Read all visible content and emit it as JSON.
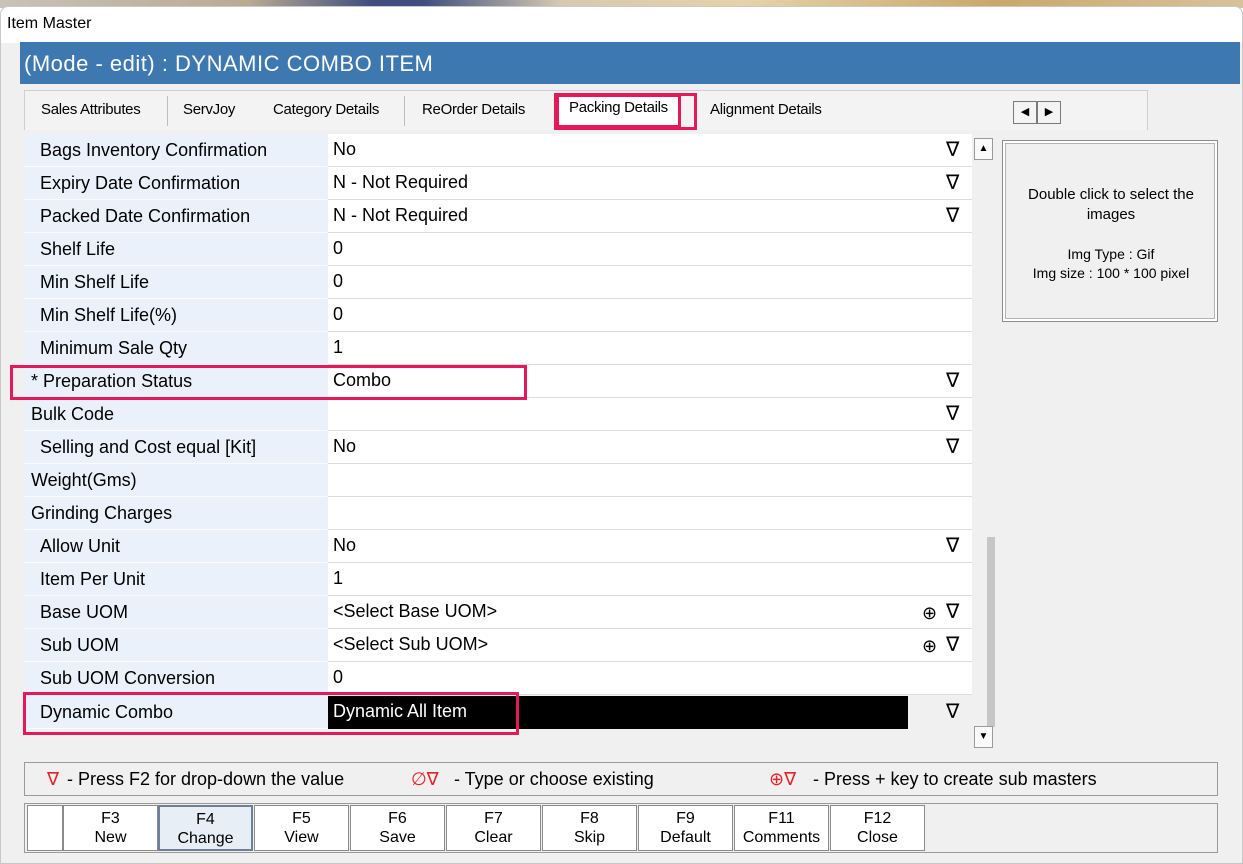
{
  "window": {
    "title": "Item Master"
  },
  "mode": {
    "text": "(Mode - edit)  :  DYNAMIC COMBO ITEM"
  },
  "tabs": [
    {
      "label": "Sales Attributes"
    },
    {
      "label": "ServJoy"
    },
    {
      "label": "Category Details"
    },
    {
      "label": "ReOrder Details"
    },
    {
      "label": "Packing Details",
      "active": true
    },
    {
      "label": "Alignment Details"
    }
  ],
  "tab_nav": {
    "prev": "◀",
    "next": "▶"
  },
  "properties": [
    {
      "label": "Bags Inventory Confirmation",
      "value": "No",
      "dropdown": true
    },
    {
      "label": "Expiry Date Confirmation",
      "value": "N - Not Required",
      "dropdown": true
    },
    {
      "label": "Packed Date Confirmation",
      "value": "N - Not Required",
      "dropdown": true
    },
    {
      "label": "Shelf Life",
      "value": "0"
    },
    {
      "label": "Min Shelf Life",
      "value": "0"
    },
    {
      "label": "Min Shelf Life(%)",
      "value": "0"
    },
    {
      "label": "Minimum Sale Qty",
      "value": "1"
    },
    {
      "label": "* Preparation Status",
      "value": "Combo",
      "dropdown": true
    },
    {
      "label": "Bulk Code",
      "value": "",
      "dropdown": true
    },
    {
      "label": "Selling and Cost equal [Kit]",
      "value": "No",
      "dropdown": true
    },
    {
      "label": "Weight(Gms)",
      "value": ""
    },
    {
      "label": "Grinding Charges",
      "value": ""
    },
    {
      "label": "Allow Unit",
      "value": "No",
      "dropdown": true
    },
    {
      "label": "Item Per Unit",
      "value": "1"
    },
    {
      "label": "Base UOM",
      "value": "<Select Base UOM>",
      "dropdown": true,
      "create": true
    },
    {
      "label": "Sub UOM",
      "value": "<Select Sub UOM>",
      "dropdown": true,
      "create": true
    },
    {
      "label": "Sub UOM Conversion",
      "value": "0"
    },
    {
      "label": "Dynamic Combo",
      "value": "Dynamic All Item",
      "dropdown": true,
      "selected": true
    }
  ],
  "glyphs": {
    "dropdown": "∇",
    "create": "⊕",
    "type_choose": "∅∇",
    "create_dd": "⊕∇"
  },
  "image_panel": {
    "hint": "Double click to select the images",
    "img_type": "Img Type : Gif",
    "img_size": "Img size : 100 * 100 pixel"
  },
  "legend": {
    "dropdown": "- Press F2 for drop-down the value",
    "type_choose": "- Type or choose existing",
    "create": "- Press + key to create sub masters"
  },
  "function_keys": [
    {
      "key": "F3",
      "label": "New"
    },
    {
      "key": "F4",
      "label": "Change",
      "pressed": true
    },
    {
      "key": "F5",
      "label": "View"
    },
    {
      "key": "F6",
      "label": "Save"
    },
    {
      "key": "F7",
      "label": "Clear"
    },
    {
      "key": "F8",
      "label": "Skip"
    },
    {
      "key": "F9",
      "label": "Default"
    },
    {
      "key": "F11",
      "label": "Comments"
    },
    {
      "key": "F12",
      "label": "Close"
    }
  ],
  "colors": {
    "accent": "#3d78b0",
    "highlight": "#e5185a",
    "legend_red": "#e0242a",
    "label_bg": "#eaf1fb"
  }
}
